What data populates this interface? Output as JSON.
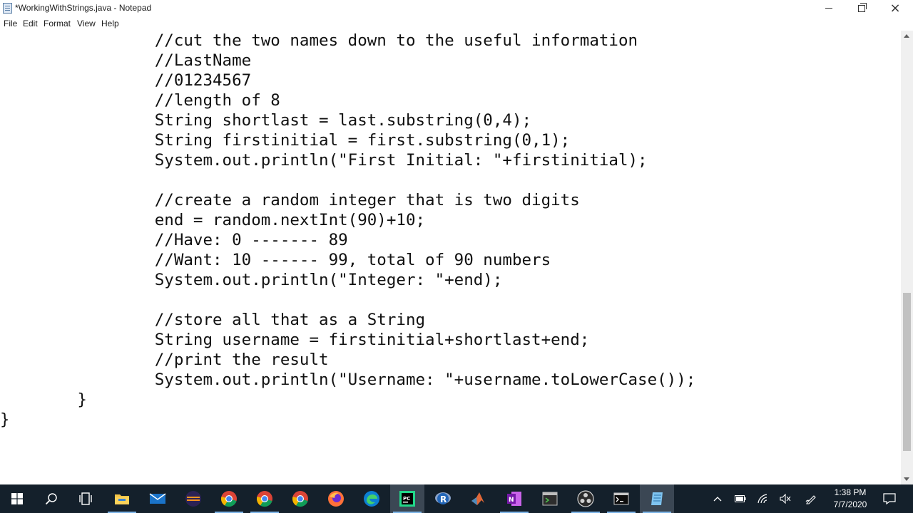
{
  "window": {
    "title": "*WorkingWithStrings.java - Notepad",
    "controls": {
      "minimize": "minimize",
      "restore": "restore",
      "close": "×"
    }
  },
  "menu": [
    "File",
    "Edit",
    "Format",
    "View",
    "Help"
  ],
  "code_lines": [
    "                //cut the two names down to the useful information",
    "                //LastName",
    "                //01234567",
    "                //length of 8",
    "                String shortlast = last.substring(0,4);",
    "                String firstinitial = first.substring(0,1);",
    "                System.out.println(\"First Initial: \"+firstinitial);",
    "",
    "                //create a random integer that is two digits",
    "                end = random.nextInt(90)+10;",
    "                //Have: 0 ------- 89",
    "                //Want: 10 ------ 99, total of 90 numbers",
    "                System.out.println(\"Integer: \"+end);",
    "",
    "                //store all that as a String",
    "                String username = firstinitial+shortlast+end;",
    "                //print the result",
    "                System.out.println(\"Username: \"+username.toLowerCase());",
    "        }",
    "}"
  ],
  "taskbar": {
    "apps": [
      "windows-start",
      "search",
      "task-view",
      "file-explorer",
      "mail",
      "eclipse",
      "chrome",
      "chrome",
      "chrome",
      "firefox",
      "edge",
      "pycharm",
      "r",
      "matlab",
      "onenote",
      "terminal-app",
      "obs",
      "command-prompt",
      "notepad"
    ],
    "tray_icons": [
      "chevron-up",
      "battery",
      "wifi",
      "volume-muted",
      "pen"
    ],
    "time": "1:38 PM",
    "date": "7/7/2020"
  },
  "colors": {
    "taskbar": "#14202b",
    "editor_bg": "#ffffff",
    "text": "#111111",
    "accent": "#7db5e8"
  }
}
